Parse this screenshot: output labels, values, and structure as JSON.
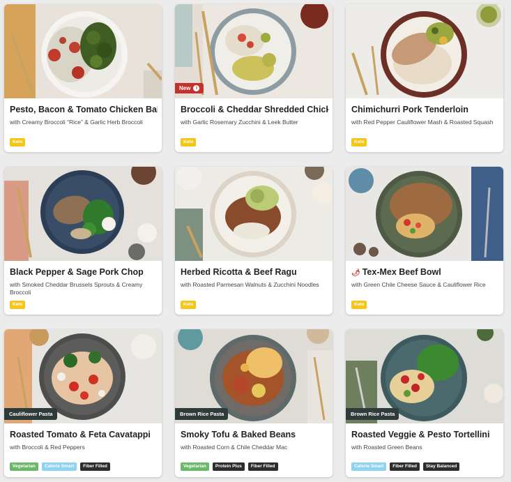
{
  "colors": {
    "keto": "#f5c518",
    "vegetarian": "#6cb86b",
    "calorie_smart": "#8fd3f2",
    "dark_tag": "#2d2d2d",
    "new_badge": "#c4302b"
  },
  "cards": [
    {
      "title": "Pesto, Bacon & Tomato Chicken Bake",
      "subtitle": "with Creamy Broccoli “Rice” & Garlic Herb Broccoli",
      "tags": [
        "Keto"
      ]
    },
    {
      "title": "Broccoli & Cheddar Shredded Chicken",
      "subtitle": "with Garlic Rosemary Zucchini & Leek Butter",
      "tags": [
        "Keto"
      ],
      "badge": "New"
    },
    {
      "title": "Chimichurri Pork Tenderloin",
      "subtitle": "with Red Pepper Cauliflower Mash & Roasted Squash",
      "tags": [
        "Keto"
      ]
    },
    {
      "title": "Black Pepper & Sage Pork Chop",
      "subtitle": "with Smoked Cheddar Brussels Sprouts & Creamy Broccoli",
      "tags": [
        "Keto"
      ]
    },
    {
      "title": "Herbed Ricotta & Beef Ragu",
      "subtitle": "with Roasted Parmesan Walnuts & Zucchini Noodles",
      "tags": [
        "Keto"
      ]
    },
    {
      "title": "Tex-Mex Beef Bowl",
      "subtitle": "with Green Chile Cheese Sauce & Cauliflower Rice",
      "tags": [
        "Keto"
      ],
      "icon": "chili-pepper-icon"
    },
    {
      "title": "Roasted Tomato & Feta Cavatappi",
      "subtitle": "with Broccoli & Red Peppers",
      "tags": [
        "Vegetarian",
        "Calorie Smart",
        "Fiber Filled"
      ],
      "badge": "Cauliflower Pasta"
    },
    {
      "title": "Smoky Tofu & Baked Beans",
      "subtitle": "with Roasted Corn & Chile Cheddar Mac",
      "tags": [
        "Vegetarian",
        "Protein Plus",
        "Fiber Filled"
      ],
      "badge": "Brown Rice Pasta"
    },
    {
      "title": "Roasted Veggie & Pesto Tortellini",
      "subtitle": "with Roasted Green Beans",
      "tags": [
        "Calorie Smart",
        "Fiber Filled",
        "Stay Balanced"
      ],
      "badge": "Brown Rice Pasta"
    }
  ]
}
